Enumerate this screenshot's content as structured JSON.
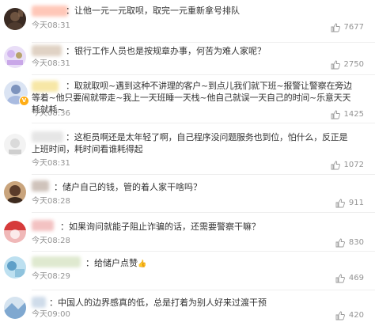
{
  "comments": [
    {
      "text": "：让他一元一元取呗，取完一元重新拿号排队",
      "time": "今天08:31",
      "likes": "7677",
      "like_icon": "thumbs-up-icon",
      "colors": [
        "#3a2a22",
        "#6d5340"
      ]
    },
    {
      "text": "：银行工作人员也是按规章办事，何苦为难人家呢？",
      "time": "今天08:31",
      "likes": "2750",
      "like_icon": "thumbs-up-icon",
      "colors": [
        "#d9c6f0",
        "#b7a36c"
      ]
    },
    {
      "text": "：取就取呗~遇到这种不讲理的客户~到点儿我们就下班~报警让警察在旁边等着~他只要闹就带走~我上一天班睡一天栈~他自己就误一天自己的时间~乐意天天耗就耗~",
      "time": "今天08:36",
      "likes": "1425",
      "like_icon": "thumbs-up-icon",
      "colors": [
        "#b8c9e6",
        "#7d93bd"
      ]
    },
    {
      "text": "：这柜员啊还是太年轻了啊，自己程序没问题服务也到位，怕什么，反正是上班时间，耗时间看谁耗得起",
      "time": "今天08:31",
      "likes": "1072",
      "like_icon": "thumbs-up-icon",
      "colors": [
        "#f0f0f0",
        "#c8c8c8"
      ]
    },
    {
      "text": "：储户自己的钱，管的着人家干啥吗？",
      "time": "今天08:28",
      "likes": "911",
      "like_icon": "thumbs-up-icon",
      "colors": [
        "#5a3b2a",
        "#c9a47c"
      ]
    },
    {
      "text": "：如果询问就能子阻止诈骗的话，还需要警察干嘛？",
      "time": "今天08:28",
      "likes": "830",
      "like_icon": "thumbs-up-icon",
      "colors": [
        "#d63b3b",
        "#f0b8b8"
      ]
    },
    {
      "text": "：给储户点赞",
      "time": "今天08:29",
      "likes": "469",
      "like_icon": "thumbs-up-icon",
      "emoji": "👍",
      "colors": [
        "#bde0f0",
        "#5fa0c8"
      ]
    },
    {
      "text": "：中国人的边界感真的低，总是打着为别人好来过渡干预",
      "time": "今天09:00",
      "likes": "420",
      "like_icon": "thumbs-up-icon",
      "colors": [
        "#7fa8d0",
        "#d6e4f0"
      ]
    }
  ]
}
